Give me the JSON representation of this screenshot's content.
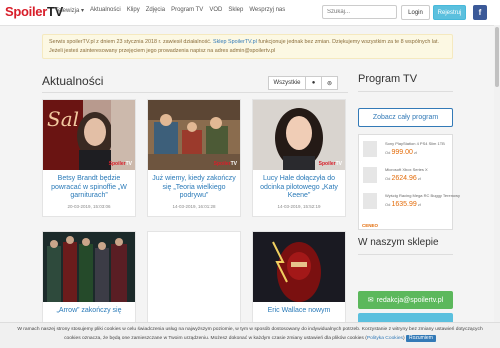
{
  "header": {
    "logo_part1": "Spoiler",
    "logo_part2": "TV",
    "nav": [
      "Telewizja ▾",
      "Aktualności",
      "Klipy",
      "Zdjęcia",
      "Program TV",
      "VOD",
      "Sklep",
      "Wesprzyj nas"
    ],
    "search_placeholder": "Szukaj...",
    "login_label": "Login",
    "register_label": "Rejestruj",
    "facebook_label": "f"
  },
  "notice": {
    "text_before": "Serwis spoilerTV.pl z dniem 23 stycznia 2018 r. zawiesił działalność. ",
    "link": "Sklep SpoilerTV.pl",
    "text_after": " funkcjonuje jednak bez zmian. Dziękujemy wszystkim za te 8 wspólnych lat. Jeżeli jesteś zainteresowany przejęciem jego prowadzenia napisz na adres admin@spoilertv.pl"
  },
  "news": {
    "title": "Aktualności",
    "filter_all": "Wszystkie",
    "filter_icon2": "●",
    "filter_icon3": "⊚",
    "cards": [
      {
        "title": "Betsy Brandt będzie powracać w spinoffie „W garniturach”",
        "date": "20-03-2019, 15:03:06"
      },
      {
        "title": "Już wiemy, kiedy zakończy się „Teoria wielkiego podrywu”",
        "date": "14-03-2019, 16:01:28"
      },
      {
        "title": "Lucy Hale dołączyła do odcinka pilotowego „Katy Keene”",
        "date": "14-03-2019, 15:52:19"
      },
      {
        "title": "„Arrow” zakończy się",
        "date": ""
      },
      {
        "title": "",
        "date": ""
      },
      {
        "title": "Eric Wallace nowym",
        "date": ""
      }
    ]
  },
  "watermark": {
    "part1": "Spoiler",
    "part2": "TV"
  },
  "sidebar": {
    "program_title": "Program TV",
    "program_button": "Zobacz cały program",
    "ad_items": [
      {
        "name": "Sony PlayStation 4 PS4 Slim 1TB",
        "price_prefix": "Od",
        "price": "999.00",
        "currency": "zł"
      },
      {
        "name": "Microsoft Xbox Series X",
        "price_prefix": "Od",
        "price": "2624.96",
        "currency": "zł"
      },
      {
        "name": "Wyścig Racing Mega RC Buggy Terenowy",
        "price_prefix": "Od",
        "price": "1635.99",
        "currency": "zł"
      }
    ],
    "ad_brand": "CENEO",
    "shop_title": "W naszym sklepie",
    "mail_button": "redakcja@spoilertv.pl"
  },
  "cookie": {
    "text1": "W ramach naszej strony stosujemy pliki cookies w celu świadczenia usług na najwyższym poziomie, w tym w sposób dostosowany do indywidualnych potrzeb. Korzystanie z witryny bez zmiany ustawień dotyczących",
    "text2": "cookies oznacza, że będą one zamieszczane w Twoim urządzeniu. Możesz dokonać w każdym czasie zmiany ustawień dla plików cookies (",
    "link": "Polityka Cookies",
    "text3": ")",
    "button": "Rozumiem"
  }
}
